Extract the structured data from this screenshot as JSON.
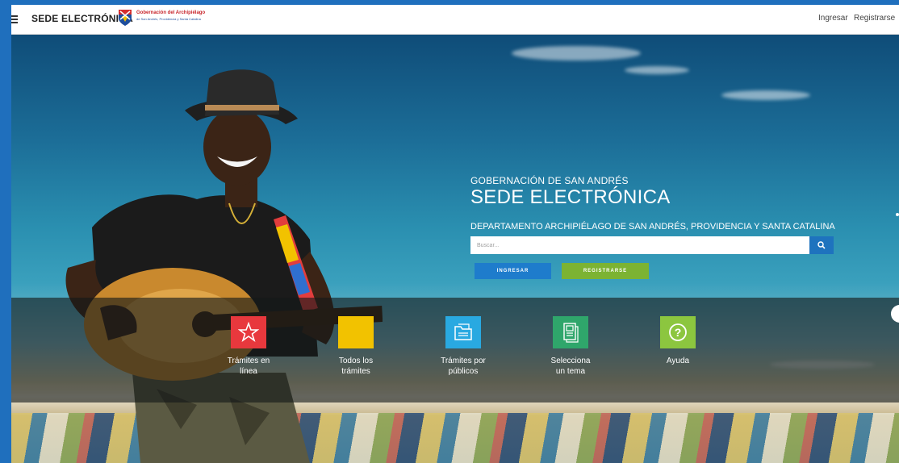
{
  "header": {
    "menu_icon": "hamburger-icon",
    "brand": "SEDE ELECTRÓNICA",
    "gov_logo_title": "Gobernación del Archipiélago",
    "gov_logo_subtitle": "de San Andrés, Providencia y Santa Catalina",
    "login_link": "Ingresar",
    "register_link": "Registrarse"
  },
  "hero": {
    "org": "GOBERNACIÓN DE SAN ANDRÉS",
    "title": "SEDE ELECTRÓNICA",
    "department": "DEPARTAMENTO ARCHIPIÉLAGO DE SAN ANDRÉS, PROVIDENCIA Y SANTA CATALINA",
    "search_placeholder": "Buscar...",
    "search_icon": "search-icon",
    "login_button": "INGRESAR",
    "register_button": "REGISTRARSE"
  },
  "tiles": [
    {
      "label": "Trámites en\nlínea",
      "icon": "star-icon",
      "color": "#e8383d"
    },
    {
      "label": "Todos los\ntrámites",
      "icon": "square-icon",
      "color": "#f2c200"
    },
    {
      "label": "Trámites por\npúblicos",
      "icon": "folder-icon",
      "color": "#29a9e1"
    },
    {
      "label": "Selecciona\nun tema",
      "icon": "document-icon",
      "color": "#2fa66b"
    },
    {
      "label": "Ayuda",
      "icon": "help-icon",
      "color": "#8cc63f"
    }
  ],
  "colors": {
    "primary_blue": "#1e7ccc",
    "register_green": "#7cb332",
    "page_border": "#1f6fbd"
  }
}
